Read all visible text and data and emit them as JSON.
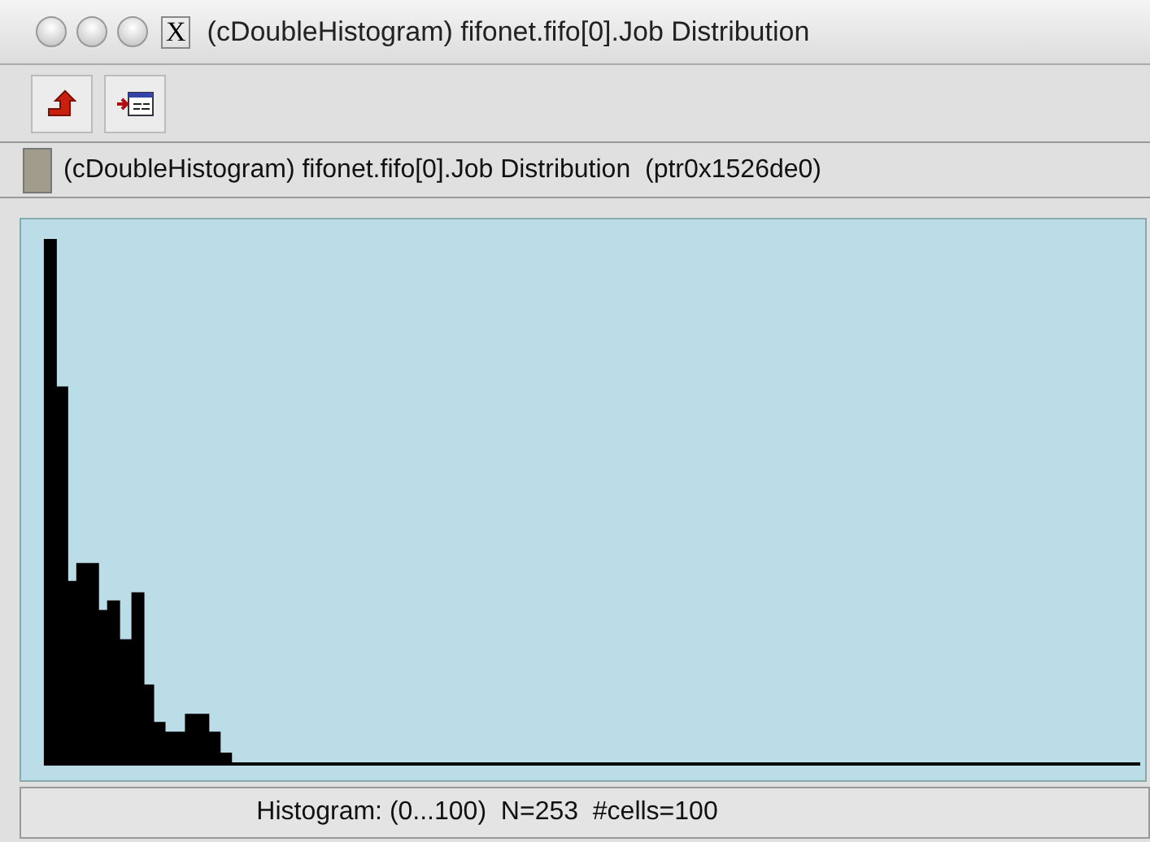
{
  "window": {
    "title": "(cDoubleHistogram) fifonet.fifo[0].Job Distribution",
    "close_glyph": "X"
  },
  "info_bar": {
    "text": "(cDoubleHistogram) fifonet.fifo[0].Job Distribution  (ptr0x1526de0)"
  },
  "status_bar": {
    "text": "Histogram: (0...100)  N=253  #cells=100"
  }
}
